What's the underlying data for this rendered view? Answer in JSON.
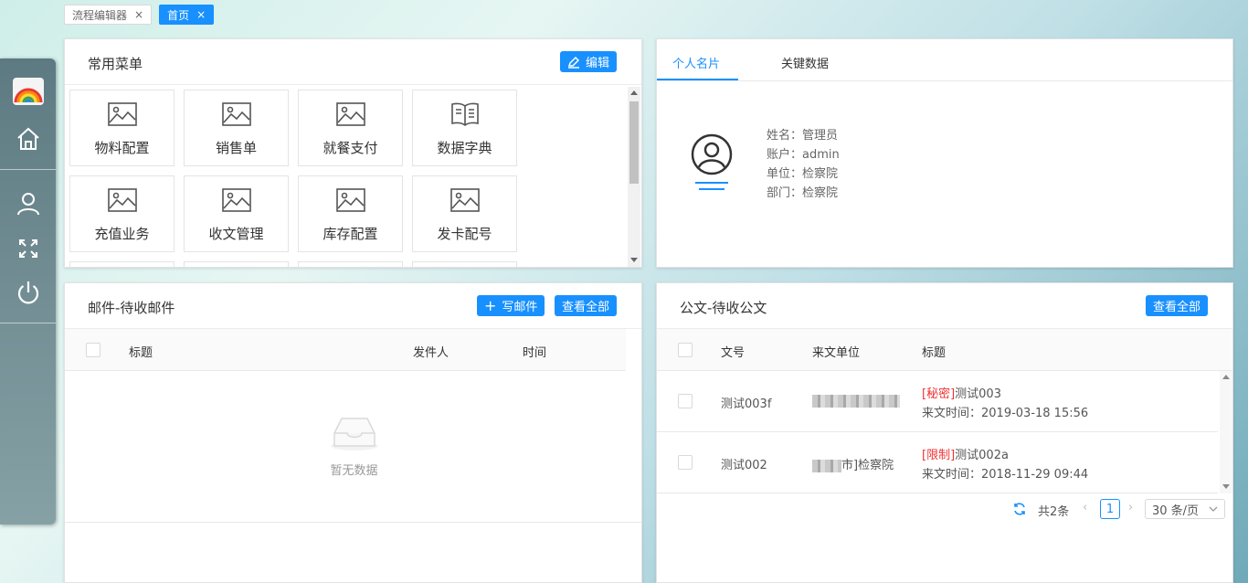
{
  "tabs": [
    {
      "label": "流程编辑器",
      "close": "×",
      "active": false
    },
    {
      "label": "首页",
      "close": "×",
      "active": true
    }
  ],
  "colors": {
    "primary": "#1890ff",
    "secret": "#e33333"
  },
  "menu_panel": {
    "title": "常用菜单",
    "edit_label": "编辑",
    "items": [
      {
        "label": "物料配置",
        "icon": "image-icon"
      },
      {
        "label": "销售单",
        "icon": "image-icon"
      },
      {
        "label": "就餐支付",
        "icon": "image-icon"
      },
      {
        "label": "数据字典",
        "icon": "book-icon"
      },
      {
        "label": "充值业务",
        "icon": "image-icon"
      },
      {
        "label": "收文管理",
        "icon": "image-icon"
      },
      {
        "label": "库存配置",
        "icon": "image-icon"
      },
      {
        "label": "发卡配号",
        "icon": "image-icon"
      }
    ]
  },
  "profile_panel": {
    "tabs": [
      "个人名片",
      "关键数据"
    ],
    "fields": [
      {
        "label": "姓名：",
        "value": "管理员"
      },
      {
        "label": "账户：",
        "value": "admin"
      },
      {
        "label": "单位：",
        "value": "检察院"
      },
      {
        "label": "部门：",
        "value": "检察院"
      }
    ]
  },
  "mail_panel": {
    "title": "邮件-待收邮件",
    "write_label": "写邮件",
    "view_all_label": "查看全部",
    "columns": [
      "标题",
      "发件人",
      "时间"
    ],
    "empty_text": "暂无数据"
  },
  "doc_panel": {
    "title": "公文-待收公文",
    "view_all_label": "查看全部",
    "columns": [
      "文号",
      "来文单位",
      "标题"
    ],
    "rows": [
      {
        "number": "测试003f",
        "unit_suffix": "",
        "tag": "[秘密]",
        "title": "测试003",
        "time": "来文时间：2019-03-18 15:56"
      },
      {
        "number": "测试002",
        "unit_suffix": "市]检察院",
        "tag": "[限制]",
        "title": "测试002a",
        "time": "来文时间：2018-11-29 09:44"
      }
    ],
    "pager": {
      "total": "共2条",
      "page": "1",
      "page_size": "30 条/页"
    }
  }
}
